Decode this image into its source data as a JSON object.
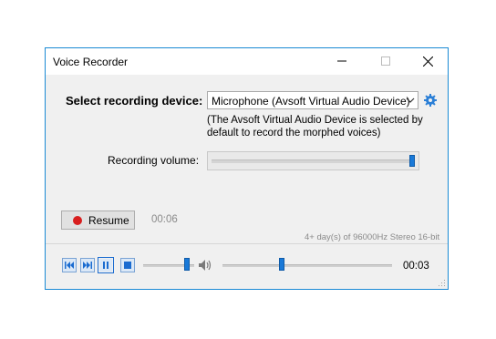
{
  "window": {
    "title": "Voice Recorder"
  },
  "device": {
    "label": "Select recording device:",
    "selected": "Microphone (Avsoft Virtual Audio Device)",
    "note": "(The Avsoft Virtual Audio Device is selected by default to record the morphed voices)"
  },
  "volume": {
    "label": "Recording volume:",
    "level": 1.0
  },
  "recorder": {
    "resume_label": "Resume",
    "elapsed": "00:06",
    "format_info": "4+ day(s) of 96000Hz Stereo 16-bit"
  },
  "player": {
    "position_fraction": 0.35,
    "volume_fraction": 0.85,
    "time": "00:03"
  },
  "colors": {
    "accent": "#1979d8",
    "record": "#d81e1e",
    "border": "#1a8ad4"
  },
  "icons": {
    "minimize": "minimize-icon",
    "maximize": "maximize-icon",
    "close": "close-icon",
    "settings": "gear-icon",
    "record": "record-dot-icon",
    "prev": "skip-back-icon",
    "next": "skip-forward-icon",
    "pause": "pause-icon",
    "stop": "stop-icon",
    "speaker": "speaker-icon"
  }
}
